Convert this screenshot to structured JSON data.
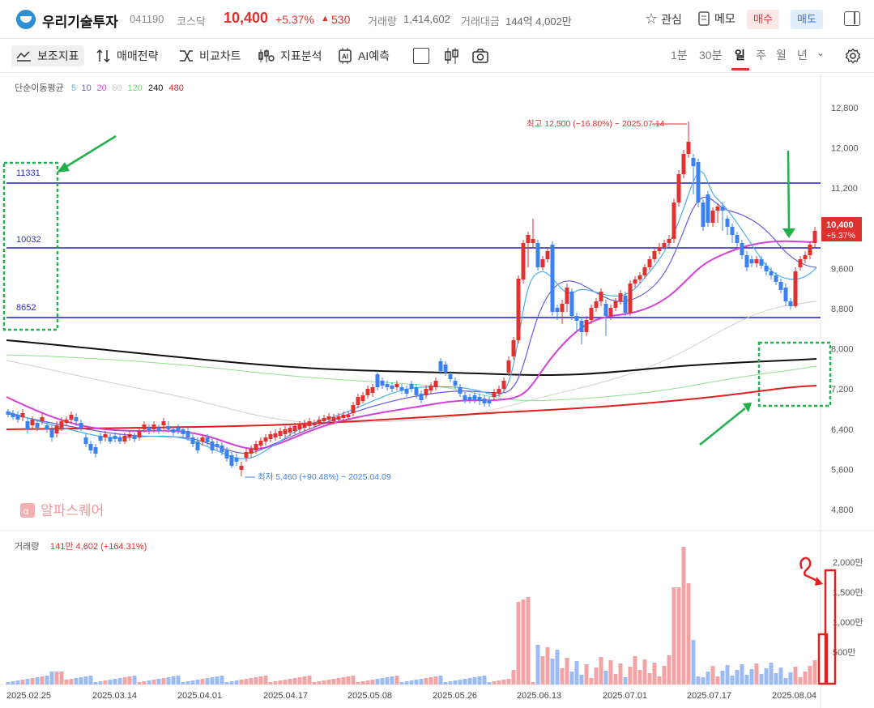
{
  "header": {
    "stock_name": "우리기술투자",
    "code": "041190",
    "market": "코스닥",
    "price": "10,400",
    "change_pct": "+5.37%",
    "change_abs": "530",
    "volume_label": "거래량",
    "volume": "1,414,602",
    "amount_label": "거래대금",
    "amount": "144억 4,002만",
    "watch_label": "관심",
    "memo_label": "메모",
    "buy_label": "매수",
    "sell_label": "매도"
  },
  "toolbar": {
    "indicators": "보조지표",
    "strategy": "매매전략",
    "compare": "비교차트",
    "analysis": "지표분석",
    "ai": "AI예측",
    "periods": [
      "1분",
      "30분",
      "일",
      "주",
      "월",
      "년"
    ],
    "active_period": "일"
  },
  "chart": {
    "ma_label": "단순이동평균",
    "ma_periods": [
      {
        "v": "5",
        "color": "#5ab3f0"
      },
      {
        "v": "10",
        "color": "#6a5ae0"
      },
      {
        "v": "20",
        "color": "#d24ad8"
      },
      {
        "v": "60",
        "color": "#c7c7c7"
      },
      {
        "v": "120",
        "color": "#7bd87b"
      },
      {
        "v": "240",
        "color": "#111111"
      },
      {
        "v": "480",
        "color": "#e02020"
      }
    ],
    "y_ticks": [
      "12,800",
      "12,000",
      "11,200",
      "10,400",
      "9,600",
      "8,800",
      "8,000",
      "7,200",
      "6,400",
      "5,600",
      "4,800"
    ],
    "x_ticks": [
      "2025.02.25",
      "2025.03.14",
      "2025.04.01",
      "2025.04.17",
      "2025.05.08",
      "2025.05.26",
      "2025.06.13",
      "2025.07.01",
      "2025.07.17",
      "2025.08.04"
    ],
    "high_annotation": "최고 12,500 (−16.80%) − 2025.07.14",
    "low_annotation": "최저 5,460 (+90.48%) − 2025.04.09",
    "hlines": [
      "11331",
      "10032",
      "8652"
    ],
    "current_price": "10,400",
    "current_change": "+5.37%",
    "watermark": "알파스퀘어",
    "volume_label": "거래량",
    "volume_value": "141만 4,602 (+164.31%)",
    "vol_ticks": [
      "2,000만",
      "1,500만",
      "1,000만",
      "500만"
    ]
  },
  "chart_data": {
    "type": "candlestick",
    "y_ticks": [
      12800,
      12000,
      11200,
      10400,
      9600,
      8800,
      8000,
      7200,
      6400,
      5600,
      4800
    ],
    "horizontal_lines": [
      11331,
      10032,
      8652
    ],
    "high": 12500,
    "low": 5460,
    "last_close": 10400,
    "volume_ticks": [
      20000000,
      15000000,
      10000000,
      5000000
    ],
    "last_volume": 1414602
  },
  "colors": {
    "up": "#e03131",
    "down": "#3b82f0",
    "accent_green": "#21b04b"
  }
}
